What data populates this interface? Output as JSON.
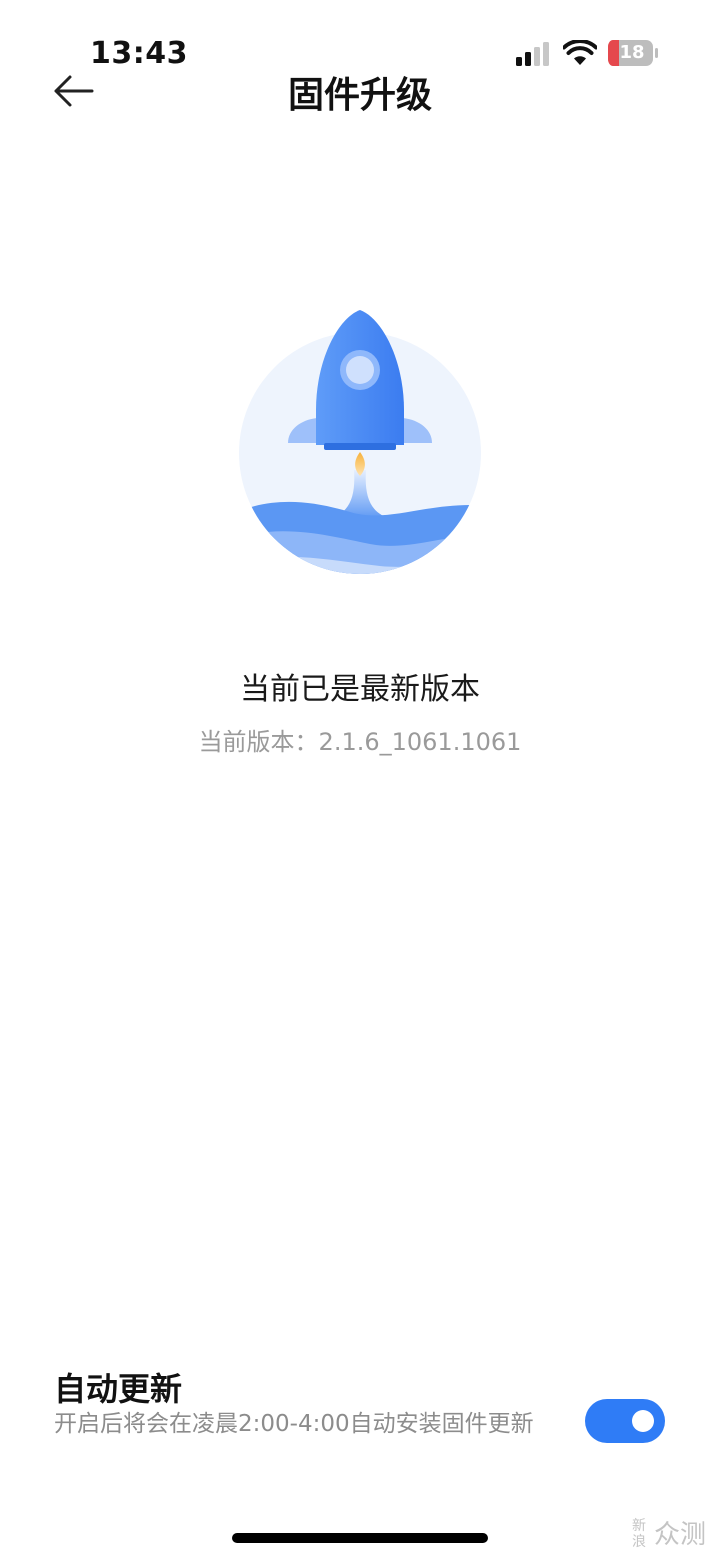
{
  "status_bar": {
    "time": "13:43",
    "battery": "18",
    "battery_color": "#e5484d"
  },
  "header": {
    "title": "固件升级"
  },
  "illustration": {
    "icon": "rocket-launch-icon",
    "colors": {
      "circle": "#eef4fd",
      "rocket": "#4e8ef7",
      "rocket_dark": "#2e6fe0",
      "window": "#a9c8fb",
      "flame": "#f5a623",
      "wave": "#5b97f3"
    }
  },
  "status": {
    "title": "当前已是最新版本",
    "version_text": "当前版本：2.1.6_1061.1061"
  },
  "auto_update": {
    "title": "自动更新",
    "description": "开启后将会在凌晨2:00-4:00自动安装固件更新",
    "enabled": true,
    "toggle_color": "#2f7cf6"
  },
  "watermark": {
    "small": "新浪",
    "big": "众测"
  }
}
